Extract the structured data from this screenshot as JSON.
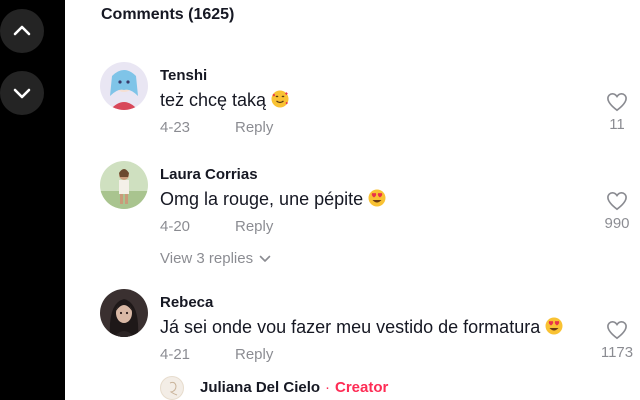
{
  "header": {
    "title": "Comments (1625)"
  },
  "nav": {
    "up_icon": "chevron-up-icon",
    "down_icon": "chevron-down-icon"
  },
  "comments": [
    {
      "username": "Tenshi",
      "text": "też chcę taką",
      "emoji": "smiling-face-with-hearts",
      "date": "4-23",
      "reply": "Reply",
      "likes": "11"
    },
    {
      "username": "Laura Corrias",
      "text": "Omg la rouge, une pépite",
      "emoji": "heart-eyes",
      "date": "4-20",
      "reply": "Reply",
      "likes": "990",
      "view_replies": "View 3 replies"
    },
    {
      "username": "Rebeca",
      "text": "Já sei onde vou fazer meu vestido de formatura",
      "emoji": "heart-eyes",
      "date": "4-21",
      "reply": "Reply",
      "likes": "1173"
    }
  ],
  "sub_reply": {
    "username": "Juliana Del Cielo",
    "separator": "·",
    "tag": "Creator"
  },
  "colors": {
    "accent": "#fe2c55",
    "text": "#161823",
    "muted": "#8a8b91",
    "rail": "#000000"
  }
}
